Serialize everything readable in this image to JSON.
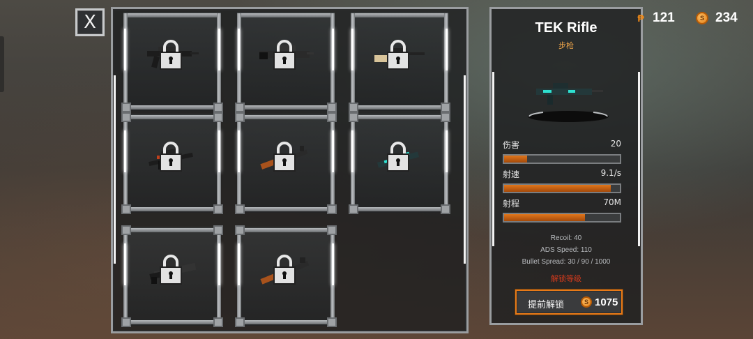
{
  "close_label": "X",
  "colors": {
    "accent_orange": "#e87a18",
    "bar_fill": "#d06a14",
    "warn_red": "#d23a1c",
    "category_orange": "#f0a64a"
  },
  "currency": {
    "premium": {
      "icon": "pixel-coin-icon",
      "glyph": "₱",
      "value": "121"
    },
    "coins": {
      "icon": "coin-icon",
      "glyph": "S",
      "value": "234"
    }
  },
  "weapon_slots": [
    {
      "weapon_icon": "assault-rifle-icon",
      "locked": true
    },
    {
      "weapon_icon": "machine-gun-icon",
      "locked": true
    },
    {
      "weapon_icon": "sniper-rifle-icon",
      "locked": true
    },
    {
      "weapon_icon": "scoped-rifle-icon",
      "locked": true
    },
    {
      "weapon_icon": "ak-rifle-icon",
      "locked": true
    },
    {
      "weapon_icon": "tek-rifle-icon",
      "locked": true
    },
    {
      "weapon_icon": "shotgun-icon",
      "locked": true
    },
    {
      "weapon_icon": "wooden-rifle-icon",
      "locked": true
    }
  ],
  "detail": {
    "name": "TEK Rifle",
    "category": "步枪",
    "stats": [
      {
        "label": "伤害",
        "value": "20",
        "fill": 0.2
      },
      {
        "label": "射速",
        "value": "9.1/s",
        "fill": 0.92
      },
      {
        "label": "射程",
        "value": "70M",
        "fill": 0.7
      }
    ],
    "extras": [
      "Recoil: 40",
      "ADS Speed: 110",
      "Bullet Spread: 30 / 90 / 1000"
    ],
    "requirement": "解锁等级",
    "unlock_button": {
      "label": "提前解锁",
      "coin_glyph": "S",
      "price": "1075"
    }
  }
}
